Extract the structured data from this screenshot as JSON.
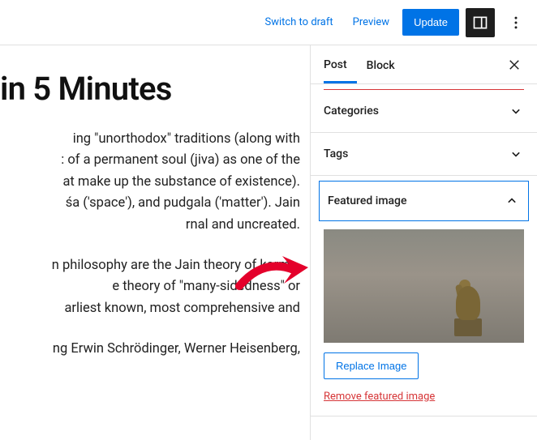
{
  "topbar": {
    "switch_draft": "Switch to draft",
    "preview": "Preview",
    "update": "Update"
  },
  "editor": {
    "title": "in 5 Minutes",
    "para1": "ing \"unorthodox\" traditions (along with\n: of a permanent soul (jiva) as one of the\nat make up the substance of existence).\nśa ('space'), and pudgala ('matter'). Jain\nrnal and uncreated.",
    "para2": "n philosophy are the Jain theory of karma,\ne theory of \"many-sidedness\" or\narliest known, most comprehensive and",
    "para3": "ng Erwin Schrödinger, Werner Heisenberg,"
  },
  "sidebar": {
    "tabs": {
      "post": "Post",
      "block": "Block"
    },
    "panels": {
      "categories": "Categories",
      "tags": "Tags",
      "featured": "Featured image"
    },
    "replace_btn": "Replace Image",
    "remove_link": "Remove featured image"
  },
  "icons": {
    "settings": "settings-panel-icon",
    "more": "more-icon",
    "close": "close-icon",
    "chev_down": "chevron-down-icon",
    "chev_up": "chevron-up-icon"
  }
}
